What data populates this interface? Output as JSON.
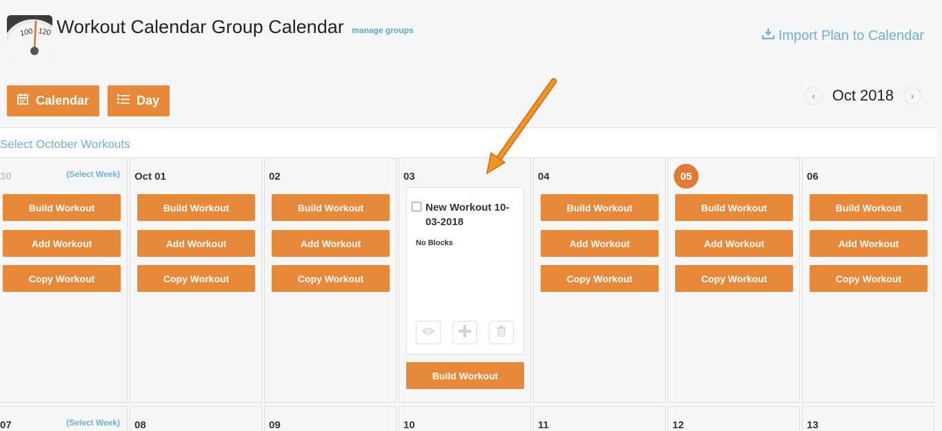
{
  "header": {
    "title": "Workout Calendar Group Calendar",
    "manage_groups": "manage groups",
    "import_plan": "Import Plan to Calendar"
  },
  "toolbar": {
    "calendar_label": "Calendar",
    "day_label": "Day",
    "month_label": "Oct 2018"
  },
  "select_month": "Select October Workouts",
  "select_week": "(Select Week)",
  "actions": {
    "build": "Build Workout",
    "add": "Add Workout",
    "copy": "Copy Workout"
  },
  "week1": [
    "30",
    "Oct 01",
    "02",
    "03",
    "04",
    "05",
    "06"
  ],
  "week2": [
    "07",
    "08",
    "09",
    "10",
    "11",
    "12",
    "13"
  ],
  "today": "05",
  "workout_card": {
    "name": "New Workout 10-03-2018",
    "blocks": "No Blocks"
  },
  "colors": {
    "accent": "#e8893a",
    "link": "#6fb0cf",
    "today": "#e07b33"
  }
}
